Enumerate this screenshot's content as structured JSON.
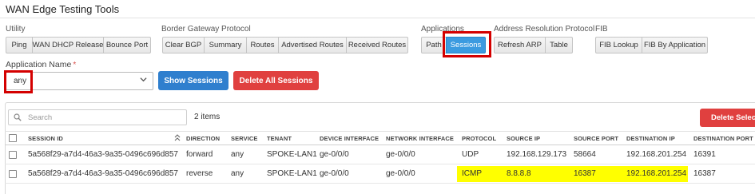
{
  "page": {
    "title": "WAN Edge Testing Tools"
  },
  "groups": [
    {
      "label": "Utility",
      "buttons": [
        "Ping",
        "WAN DHCP Release",
        "Bounce Port"
      ]
    },
    {
      "label": "Border Gateway Protocol",
      "buttons": [
        "Clear BGP",
        "Summary",
        "Routes",
        "Advertised Routes",
        "Received Routes"
      ]
    },
    {
      "label": "Applications",
      "buttons": [
        "Path",
        "Sessions"
      ]
    },
    {
      "label": "Address Resolution Protocol",
      "buttons": [
        "Refresh ARP",
        "Table"
      ]
    },
    {
      "label": "FIB",
      "buttons": [
        "FIB Lookup",
        "FIB By Application"
      ]
    }
  ],
  "form": {
    "app_name_label": "Application Name",
    "required_mark": "*",
    "app_name_value": "any",
    "show_sessions_label": "Show Sessions",
    "delete_all_label": "Delete All Sessions"
  },
  "table": {
    "search_placeholder": "Search",
    "item_count": "2 items",
    "delete_selected_label": "Delete Select",
    "columns": [
      "SESSION ID",
      "DIRECTION",
      "SERVICE",
      "TENANT",
      "DEVICE INTERFACE",
      "NETWORK INTERFACE",
      "PROTOCOL",
      "SOURCE IP",
      "SOURCE PORT",
      "DESTINATION IP",
      "DESTINATION PORT"
    ],
    "rows": [
      [
        "5a568f29-a7d4-46a3-9a35-0496c696d857",
        "forward",
        "any",
        "SPOKE-LAN1",
        "ge-0/0/0",
        "ge-0/0/0",
        "UDP",
        "192.168.129.173",
        "58664",
        "192.168.201.254",
        "16391"
      ],
      [
        "5a568f29-a7d4-46a3-9a35-0496c696d857",
        "reverse",
        "any",
        "SPOKE-LAN1",
        "ge-0/0/0",
        "ge-0/0/0",
        "ICMP",
        "8.8.8.8",
        "16387",
        "192.168.201.254",
        "16387"
      ]
    ]
  },
  "colors": {
    "accent_blue": "#2f7fce",
    "danger_red": "#e0403f",
    "highlight_red_box": "#d40000",
    "highlight_yellow": "#ffff00"
  },
  "icons": {
    "search": "search-icon",
    "dropdown": "chevron-down-icon",
    "sort": "sort-arrows-icon"
  }
}
